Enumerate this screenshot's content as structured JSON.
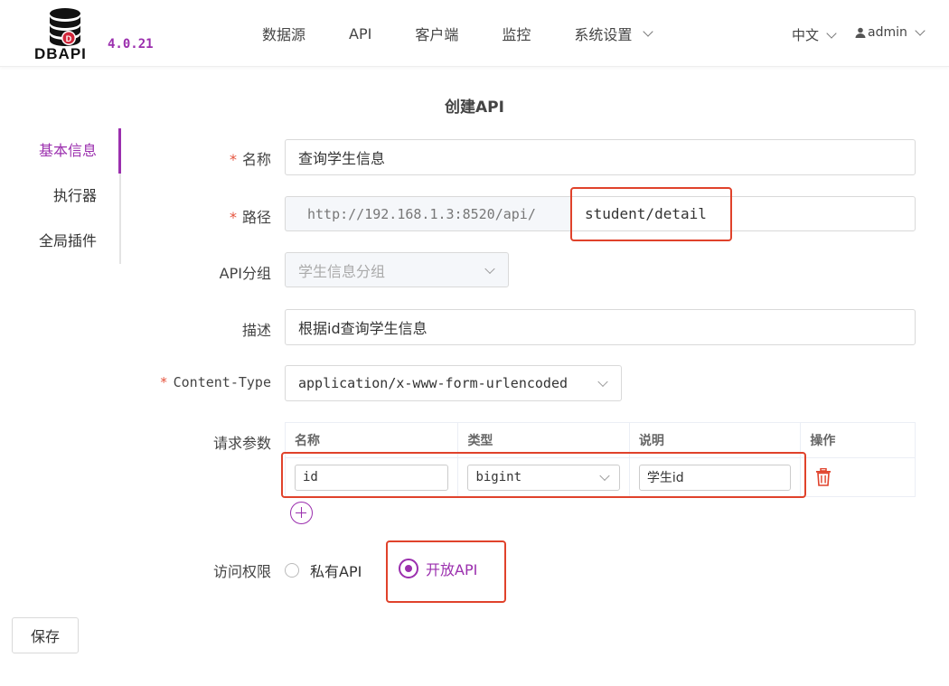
{
  "header": {
    "logo_text": "DBAPI",
    "version": "4.0.21",
    "nav": [
      "数据源",
      "API",
      "客户端",
      "监控",
      "系统设置"
    ],
    "lang": "中文",
    "user": "admin"
  },
  "page_title": "创建API",
  "tabs": [
    "基本信息",
    "执行器",
    "全局插件"
  ],
  "form": {
    "name_label": "名称",
    "name_value": "查询学生信息",
    "path_label": "路径",
    "path_prefix": "http://192.168.1.3:8520/api/",
    "path_value": "student/detail",
    "group_label": "API分组",
    "group_value": "学生信息分组",
    "desc_label": "描述",
    "desc_value": "根据id查询学生信息",
    "content_type_label": "Content-Type",
    "content_type_value": "application/x-www-form-urlencoded",
    "params_label": "请求参数",
    "params_headers": [
      "名称",
      "类型",
      "说明",
      "操作"
    ],
    "params_rows": [
      {
        "name": "id",
        "type": "bigint",
        "desc": "学生id"
      }
    ],
    "access_label": "访问权限",
    "access_private": "私有API",
    "access_public": "开放API"
  },
  "save_label": "保存",
  "colors": {
    "accent": "#9b2fae",
    "highlight": "#e0422b"
  }
}
